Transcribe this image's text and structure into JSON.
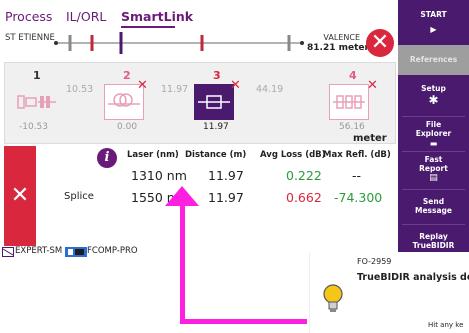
{
  "tabs": [
    {
      "label": "Process"
    },
    {
      "label": "IL/ORL"
    },
    {
      "label": "SmartLink"
    }
  ],
  "link": {
    "start_label": "ST ETIENNE",
    "end_label": "VALENCE",
    "end_distance": "81.21 meter"
  },
  "events": [
    {
      "number": "1",
      "position": "-10.53",
      "status": "ok"
    },
    {
      "number": "2",
      "position": "0.00",
      "status": "fail"
    },
    {
      "number": "3",
      "position": "11.97",
      "status": "fail",
      "selected": true
    },
    {
      "number": "4",
      "position": "56.16",
      "status": "fail"
    }
  ],
  "spans": [
    "10.53",
    "11.97",
    "44.19"
  ],
  "unit": "meter",
  "detail": {
    "type_label": "Splice",
    "info_glyph": "i",
    "fail_glyph": "✕",
    "headers": [
      "Laser (nm)",
      "Distance (m)",
      "Avg Loss (dB)",
      "Max Refl. (dB)"
    ],
    "rows": [
      {
        "laser": "1310 nm",
        "distance": "11.97",
        "loss": "0.222",
        "refl": "--"
      },
      {
        "laser": "1550 nm",
        "distance": "11.97",
        "loss": "0.662",
        "refl": "-74.300"
      }
    ]
  },
  "statusbar": [
    {
      "label": "EXPERT-SM"
    },
    {
      "label": "FCOMP-PRO"
    }
  ],
  "menu": [
    {
      "label": "START",
      "icon": "play-icon"
    },
    {
      "label": "References",
      "icon": ""
    },
    {
      "label": "Setup",
      "icon": "gear-icon"
    },
    {
      "label": "File Explorer",
      "icon": "folder-icon"
    },
    {
      "label": "Fast Report",
      "icon": "report-icon"
    },
    {
      "label": "Send Message",
      "icon": ""
    },
    {
      "label": "Replay TrueBIDIR",
      "icon": ""
    }
  ],
  "popup": {
    "code": "FO-2959",
    "message": "TrueBIDIR analysis dor",
    "hint": "Hit any ke"
  },
  "colors": {
    "accent": "#4a1a6e",
    "fail": "#d9273e",
    "pass": "#2a9d3a",
    "overlay": "#ff1fe0"
  }
}
